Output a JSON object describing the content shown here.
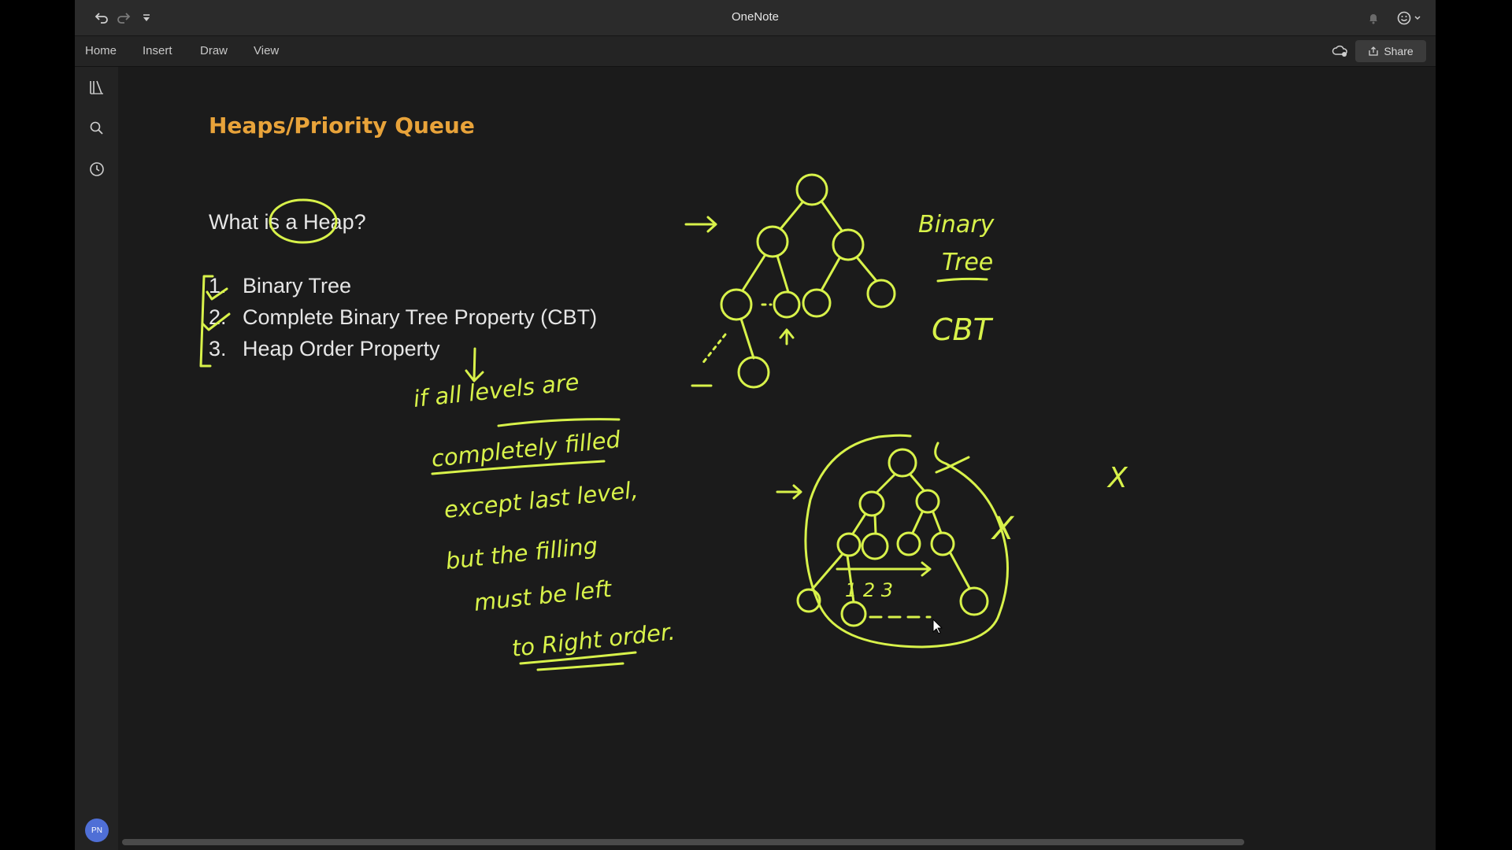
{
  "titlebar": {
    "app_title": "OneNote",
    "icons": [
      "undo-icon",
      "redo-icon",
      "customize-toolbar-icon",
      "notifications-icon",
      "feedback-icon"
    ]
  },
  "ribbon": {
    "tabs": [
      {
        "label": "Home"
      },
      {
        "label": "Insert"
      },
      {
        "label": "Draw"
      },
      {
        "label": "View"
      }
    ],
    "share_label": "Share"
  },
  "sidebar": {
    "icons": [
      "notebooks-icon",
      "search-icon",
      "recent-icon"
    ],
    "avatar_initials": "PN"
  },
  "page": {
    "title": "Heaps/Priority Queue",
    "question": "What is a Heap?",
    "properties": [
      {
        "num": "1.",
        "text": "Binary Tree"
      },
      {
        "num": "2.",
        "text": "Complete Binary Tree Property (CBT)"
      },
      {
        "num": "3.",
        "text": "Heap Order Property"
      }
    ]
  },
  "ink": {
    "color": "#d8f24a",
    "notes": [
      "if all levels are",
      "completely filled",
      "except last level,",
      "but the filling",
      "must be left",
      "to Right order."
    ],
    "labels": {
      "binary": "Binary",
      "tree": "Tree",
      "cbt": "CBT",
      "cross": "X",
      "order_numbers": "1 2 3"
    }
  },
  "colors": {
    "title": "#e8a33a",
    "canvas_bg": "#1b1b1b",
    "text": "#e6e6e6"
  }
}
